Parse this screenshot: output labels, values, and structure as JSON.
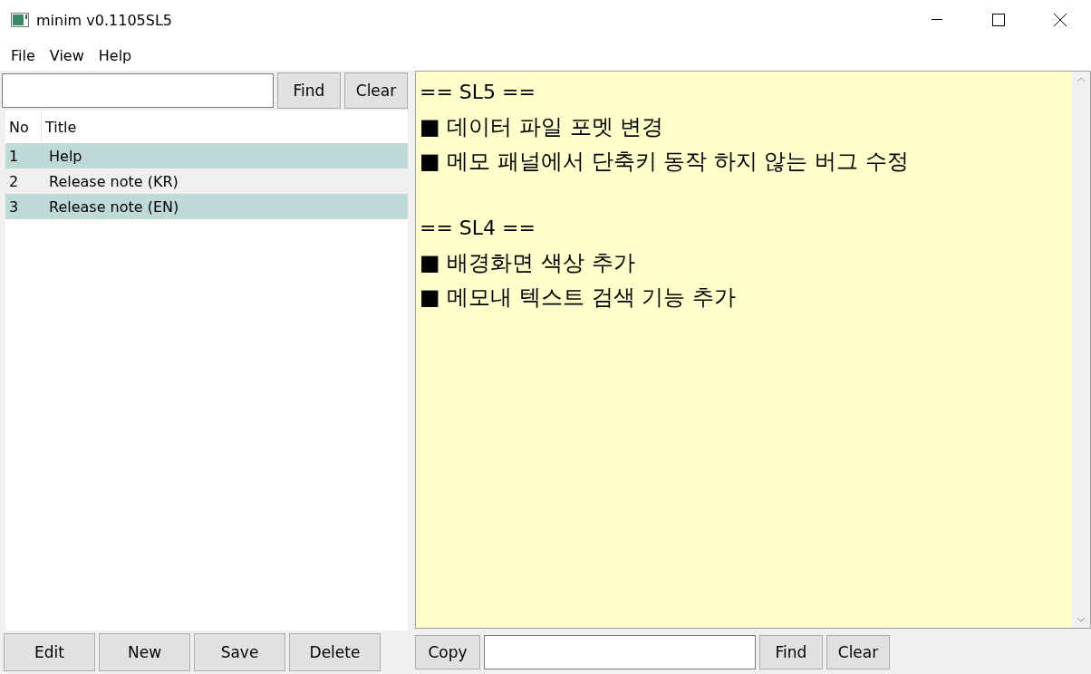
{
  "window": {
    "title": "minim v0.1105SL5"
  },
  "menu": [
    "File",
    "View",
    "Help"
  ],
  "list_search": {
    "buttons": [
      "Find",
      "Clear"
    ]
  },
  "table": {
    "columns": [
      "No",
      "Title"
    ],
    "rows": [
      {
        "no": "1",
        "title": "Help",
        "selected": true
      },
      {
        "no": "2",
        "title": "Release note (KR)",
        "selected": false
      },
      {
        "no": "3",
        "title": "Release note (EN)",
        "selected": true
      }
    ]
  },
  "memo": {
    "sections": [
      {
        "heading": "== SL5 ==",
        "items": [
          "■ 데이터 파일 포멧 변경",
          "■ 메모 패널에서 단축키 동작 하지 않는 버그 수정"
        ]
      },
      {
        "heading": "== SL4 ==",
        "items": [
          "■ 배경화면 색상 추가",
          "■ 메모내 텍스트 검색 기능 추가"
        ]
      }
    ]
  },
  "list_buttons": [
    "Edit",
    "New",
    "Save",
    "Delete"
  ],
  "memo_bar": {
    "copy": "Copy",
    "buttons": [
      "Find",
      "Clear"
    ]
  }
}
